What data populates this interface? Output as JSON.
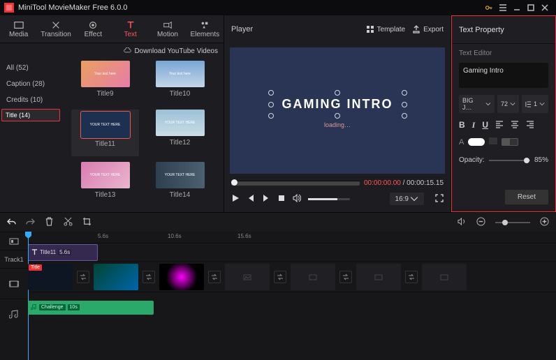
{
  "app": {
    "title": "MiniTool MovieMaker Free 6.0.0"
  },
  "tabs": [
    {
      "icon": "media",
      "label": "Media"
    },
    {
      "icon": "transition",
      "label": "Transition"
    },
    {
      "icon": "effect",
      "label": "Effect"
    },
    {
      "icon": "text",
      "label": "Text",
      "active": true
    },
    {
      "icon": "motion",
      "label": "Motion"
    },
    {
      "icon": "elements",
      "label": "Elements"
    }
  ],
  "download_label": "Download YouTube Videos",
  "categories": [
    {
      "label": "All (52)"
    },
    {
      "label": "Caption (28)"
    },
    {
      "label": "Credits (10)"
    },
    {
      "label": "Title (14)",
      "selected": true
    }
  ],
  "thumbs": [
    {
      "id": "t9",
      "cap": "Title9",
      "inner": "Your text here"
    },
    {
      "id": "t10",
      "cap": "Title10",
      "inner": "Your text here"
    },
    {
      "id": "t11",
      "cap": "Title11",
      "inner": "YOUR TEXT HERE",
      "selected": true
    },
    {
      "id": "t12",
      "cap": "Title12",
      "inner": "YOUR TEXT HERE"
    },
    {
      "id": "t13",
      "cap": "Title13",
      "inner": "YOUR TEXT HERE"
    },
    {
      "id": "t14",
      "cap": "Title14",
      "inner": "YOUR TEXT HERE"
    }
  ],
  "player": {
    "label": "Player",
    "template": "Template",
    "export": "Export",
    "overlay_text": "GAMING INTRO",
    "loading": "loading…",
    "time_current": "00:00:00.00",
    "time_total": "00:00:15.15",
    "aspect": "16:9"
  },
  "text_prop": {
    "title": "Text Property",
    "editor_label": "Text Editor",
    "value": "Gaming Intro",
    "font": "BIG J…",
    "size": "72",
    "line": "1",
    "opacity_label": "Opacity:",
    "opacity_value": "85%",
    "reset": "Reset"
  },
  "ruler": [
    "5.6s",
    "10.6s",
    "15.6s"
  ],
  "track1": {
    "label": "Track1",
    "clip": "Title11",
    "dur": "5.6s"
  },
  "vtrack": {
    "tag": "Title"
  },
  "audio": {
    "name": "Challenge",
    "dur": "10s"
  }
}
